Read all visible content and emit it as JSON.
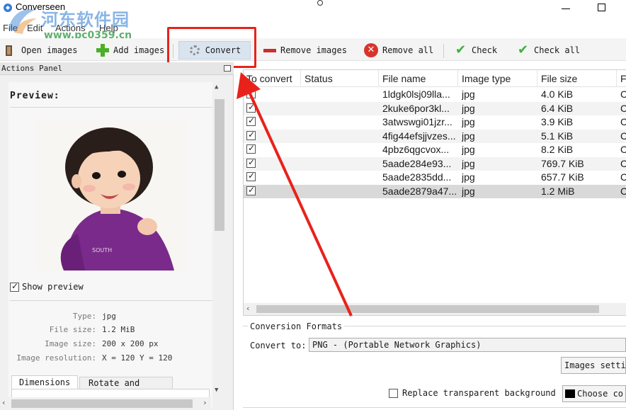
{
  "window": {
    "title": "Converseen"
  },
  "watermark": {
    "title": "河东软件园",
    "url": "www.pc0359.cn"
  },
  "menu": [
    "File",
    "Edit",
    "Actions",
    "Help"
  ],
  "toolbar": {
    "open_images": "Open images",
    "add_images": "Add images",
    "convert": "Convert",
    "remove_images": "Remove images",
    "remove_all": "Remove all",
    "check": "Check",
    "check_all": "Check all"
  },
  "actions_panel": {
    "title": "Actions Panel",
    "preview_title": "Preview:",
    "show_preview": "Show preview",
    "show_preview_checked": true,
    "info": [
      {
        "label": "Type:",
        "value": "jpg"
      },
      {
        "label": "File size:",
        "value": "1.2 MiB"
      },
      {
        "label": "Image size:",
        "value": "200 x 200 px"
      },
      {
        "label": "Image resolution:",
        "value": "X = 120 Y = 120"
      }
    ],
    "tabs": [
      "Dimensions",
      "Rotate and flip"
    ]
  },
  "table": {
    "columns": [
      "To convert",
      "Status",
      "File name",
      "Image type",
      "File size",
      "Fi"
    ],
    "rows": [
      {
        "checked": true,
        "status": "",
        "name": "1ldgk0lsj09lla...",
        "type": "jpg",
        "size": "4.0 KiB",
        "path": "C:"
      },
      {
        "checked": true,
        "status": "",
        "name": "2kuke6por3kl...",
        "type": "jpg",
        "size": "6.4 KiB",
        "path": "C:"
      },
      {
        "checked": true,
        "status": "",
        "name": "3atwswgi01jzr...",
        "type": "jpg",
        "size": "3.9 KiB",
        "path": "C:"
      },
      {
        "checked": true,
        "status": "",
        "name": "4fig44efsjjvzes...",
        "type": "jpg",
        "size": "5.1 KiB",
        "path": "C:"
      },
      {
        "checked": true,
        "status": "",
        "name": "4pbz6qgcvox...",
        "type": "jpg",
        "size": "8.2 KiB",
        "path": "C:"
      },
      {
        "checked": true,
        "status": "",
        "name": "5aade284e93...",
        "type": "jpg",
        "size": "769.7 KiB",
        "path": "C:"
      },
      {
        "checked": true,
        "status": "",
        "name": "5aade2835dd...",
        "type": "jpg",
        "size": "657.7 KiB",
        "path": "C:"
      },
      {
        "checked": true,
        "status": "",
        "name": "5aade2879a47...",
        "type": "jpg",
        "size": "1.2 MiB",
        "path": "C:"
      }
    ],
    "selected_row": 7
  },
  "formats": {
    "title": "Conversion Formats",
    "convert_to_label": "Convert to:",
    "selected_format": "PNG - (Portable Network Graphics)",
    "image_settings": "Images setti",
    "replace_bg": "Replace transparent background",
    "replace_bg_checked": false,
    "choose_color": "Choose co"
  },
  "colors": {
    "highlight": "#e8221b",
    "convert_bg": "#d9e4ef",
    "selected_row": "#d9d9d9",
    "shirt": "#7a2a8a"
  }
}
